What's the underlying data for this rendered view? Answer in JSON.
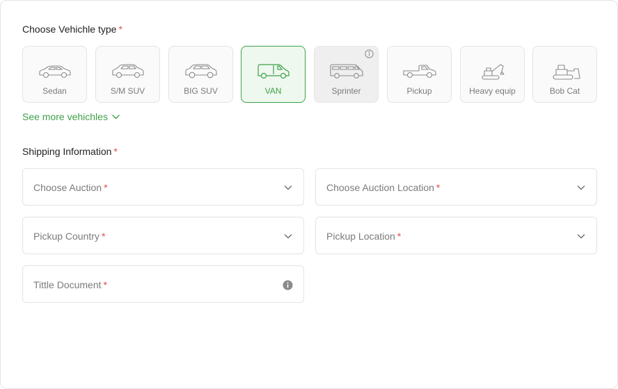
{
  "vehicle_section": {
    "title": "Choose Vehichle type",
    "required_mark": "*",
    "vehicles": [
      {
        "label": "Sedan",
        "icon": "sedan-icon",
        "state": "default"
      },
      {
        "label": "S/M SUV",
        "icon": "suv-icon",
        "state": "default"
      },
      {
        "label": "BIG SUV",
        "icon": "big-suv-icon",
        "state": "default"
      },
      {
        "label": "VAN",
        "icon": "van-icon",
        "state": "selected"
      },
      {
        "label": "Sprinter",
        "icon": "sprinter-icon",
        "state": "disabled"
      },
      {
        "label": "Pickup",
        "icon": "pickup-icon",
        "state": "default"
      },
      {
        "label": "Heavy equip",
        "icon": "excavator-icon",
        "state": "default"
      },
      {
        "label": "Bob Cat",
        "icon": "bulldozer-icon",
        "state": "default"
      }
    ],
    "see_more_label": "See more vehichles"
  },
  "shipping_section": {
    "title": "Shipping Information",
    "required_mark": "*",
    "fields": {
      "auction": {
        "label": "Choose Auction",
        "required_mark": "*"
      },
      "auction_location": {
        "label": "Choose Auction Location",
        "required_mark": "*"
      },
      "pickup_country": {
        "label": "Pickup Country",
        "required_mark": "*"
      },
      "pickup_location": {
        "label": "Pickup Location",
        "required_mark": "*"
      },
      "title_document": {
        "label": "Tittle Document",
        "required_mark": "*"
      }
    }
  },
  "colors": {
    "accent_green": "#3ea04a",
    "required_red": "#e5484d",
    "muted_text": "#7b7b7b",
    "border": "#e3e3e3"
  }
}
